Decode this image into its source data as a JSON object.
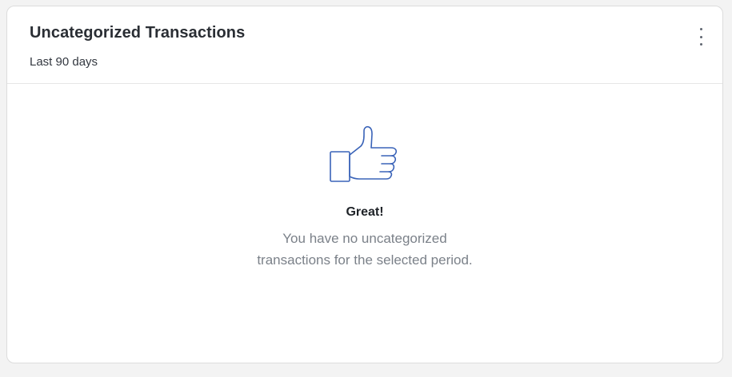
{
  "card": {
    "title": "Uncategorized Transactions",
    "subtitle": "Last 90 days",
    "menu_icon": "more-vertical-icon"
  },
  "empty_state": {
    "icon": "thumbs-up-icon",
    "heading": "Great!",
    "message": "You have no uncategorized transactions for the selected period."
  },
  "colors": {
    "icon_stroke": "#3a63b8",
    "title": "#2a2e34",
    "message": "#7b8189"
  }
}
